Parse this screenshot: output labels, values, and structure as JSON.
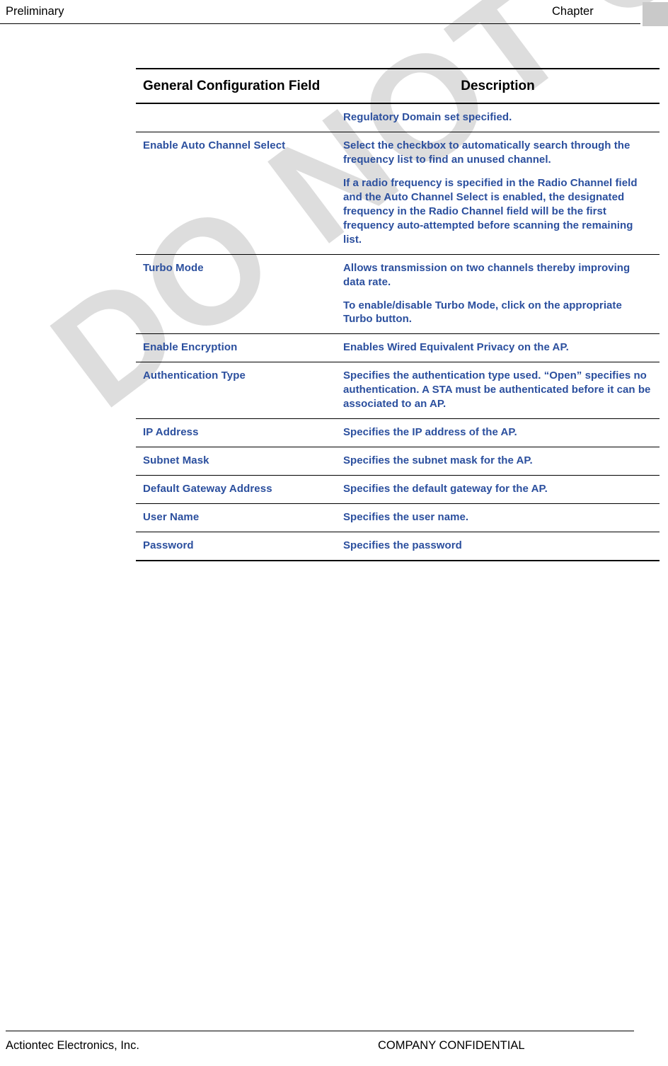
{
  "header": {
    "left": "Preliminary",
    "right": "Chapter"
  },
  "footer": {
    "left": "Actiontec Electronics, Inc.",
    "right": "COMPANY CONFIDENTIAL"
  },
  "watermark": {
    "text": "DO NOT COPY"
  },
  "table": {
    "columns": [
      "General Configuration Field",
      "Description"
    ],
    "rows": [
      {
        "field": "",
        "description": [
          "Regulatory Domain set specified."
        ]
      },
      {
        "field": "Enable Auto Channel Select",
        "description": [
          "Select the checkbox to automatically search through the frequency list to find an unused channel.",
          "If a radio frequency is specified in the Radio Channel field and the Auto Channel Select is enabled, the designated frequency in the Radio Channel field will be the first frequency auto-attempted before scanning the remaining list."
        ]
      },
      {
        "field": "Turbo Mode",
        "description": [
          "Allows transmission on two channels thereby improving data rate.",
          "To enable/disable Turbo Mode, click on the appropriate Turbo button."
        ]
      },
      {
        "field": "Enable Encryption",
        "description": [
          "Enables Wired Equivalent Privacy on the AP."
        ]
      },
      {
        "field": "Authentication Type",
        "description": [
          "Specifies the authentication type used. “Open” specifies no authentication. A STA must be authenticated before it can be associated to an AP."
        ]
      },
      {
        "field": "IP Address",
        "description": [
          "Specifies the IP address of the AP."
        ]
      },
      {
        "field": "Subnet Mask",
        "description": [
          "Specifies the subnet mask for the AP."
        ]
      },
      {
        "field": "Default Gateway Address",
        "description": [
          "Specifies the default gateway for the AP."
        ]
      },
      {
        "field": "User Name",
        "description": [
          "Specifies the user name."
        ]
      },
      {
        "field": "Password",
        "description": [
          "Specifies the password"
        ]
      }
    ]
  }
}
